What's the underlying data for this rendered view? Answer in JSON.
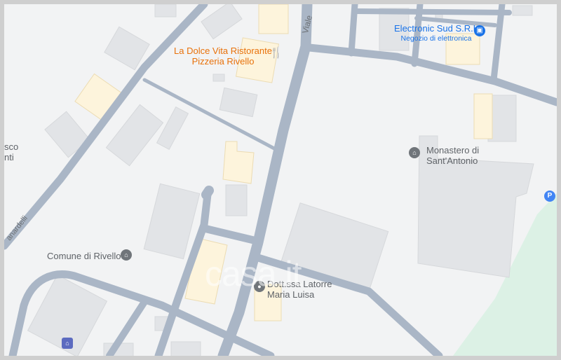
{
  "map": {
    "pois": {
      "restaurant": {
        "line1": "La Dolce Vita Ristorante",
        "line2": "Pizzeria Rivello",
        "icon": "restaurant-icon",
        "color": "#e8710a"
      },
      "electronics": {
        "line1": "Electronic Sud S.R.L",
        "line2": "Negozio di elettronica",
        "icon": "shopping-bag-icon",
        "color": "#1a73e8"
      },
      "monastery": {
        "line1": "Monastero di",
        "line2": "Sant'Antonio",
        "icon": "monastery-icon",
        "color": "#70757a"
      },
      "town_hall": {
        "label": "Comune di Rivello",
        "icon": "town-hall-icon",
        "color": "#70757a"
      },
      "doctor": {
        "line1": "Dott.ssa Latorre",
        "line2": "Maria Luisa",
        "icon": "doctor-pin-icon",
        "color": "#70757a"
      },
      "parking": {
        "label": "P",
        "icon": "parking-icon",
        "color": "#4285f4"
      },
      "edge_label": {
        "line1": "sco",
        "line2": "nti"
      }
    },
    "streets": {
      "viale": "Viale",
      "left_street": "anardelli"
    },
    "watermark": "casa.it",
    "colors": {
      "background": "#f2f3f4",
      "road": "#aab6c6",
      "building": "#e2e4e7",
      "highlight_building": "#fdf4dc",
      "park": "#dcf1e5"
    }
  }
}
